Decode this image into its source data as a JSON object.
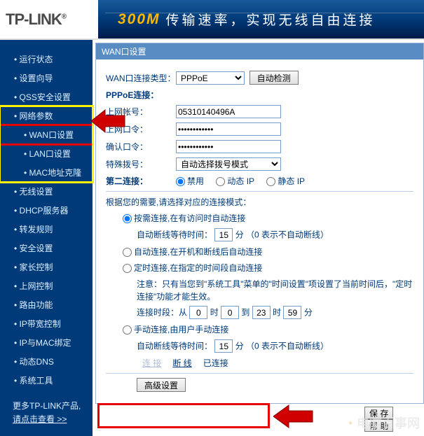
{
  "logo": "TP-LINK",
  "banner": {
    "left": "300M",
    "right": "传输速率，实现无线自由连接"
  },
  "sidebar": {
    "items": [
      "运行状态",
      "设置向导",
      "QSS安全设置",
      "网络参数",
      "WAN口设置",
      "LAN口设置",
      "MAC地址克隆",
      "无线设置",
      "DHCP服务器",
      "转发规则",
      "安全设置",
      "家长控制",
      "上网控制",
      "路由功能",
      "IP带宽控制",
      "IP与MAC绑定",
      "动态DNS",
      "系统工具"
    ],
    "footer_l1": "更多TP-LINK产品,",
    "footer_l2_pre": "请点击",
    "footer_l2_link": "查看",
    "footer_l2_post": " >>"
  },
  "panel": {
    "title": "WAN口设置",
    "conn_type_label": "WAN口连接类型：",
    "conn_type_value": "PPPoE",
    "auto_detect": "自动检测",
    "pppoe_label": "PPPoE连接：",
    "user_label": "上网帐号：",
    "user_value": "05310140496A",
    "pass_label": "上网口令：",
    "pass_value": "••••••••••••",
    "confirm_label": "确认口令：",
    "confirm_value": "••••••••••••",
    "special_label": "特殊拨号：",
    "special_value": "自动选择拨号模式",
    "second_label": "第二连接：",
    "second_opts": [
      "禁用",
      "动态 IP",
      "静态 IP"
    ],
    "second_selected": "禁用",
    "hint": "根据您的需要,请选择对应的连接模式：",
    "m1": {
      "label": "按需连接,在有访问时自动连接",
      "sub_pre": "自动断线等待时间：",
      "val": "15",
      "sub_post": "分  （0 表示不自动断线）"
    },
    "m2": {
      "label": "自动连接,在开机和断线后自动连接"
    },
    "m3": {
      "label": "定时连接,在指定的时间段自动连接",
      "note": "注意：只有当您到\"系统工具\"菜单的\"时间设置\"项设置了当前时间后，\"定时连接\"功能才能生效。",
      "time_pre": "连接时段：从",
      "h1": "0",
      "m1_": "0",
      "mid": "到",
      "h2": "23",
      "m2_": "59",
      "unit_h": "时",
      "unit_m": "分"
    },
    "m4": {
      "label": "手动连接,由用户手动连接",
      "sub_pre": "自动断线等待时间：",
      "val": "15",
      "sub_post": "分  （0 表示不自动断线）"
    },
    "connect_btn": "连 接",
    "disconnect_btn": "断 线",
    "status": "已连接",
    "adv_btn": "高级设置",
    "save_btn": "保 存",
    "help_btn": "帮 助"
  },
  "watermark": "电脑百事网"
}
